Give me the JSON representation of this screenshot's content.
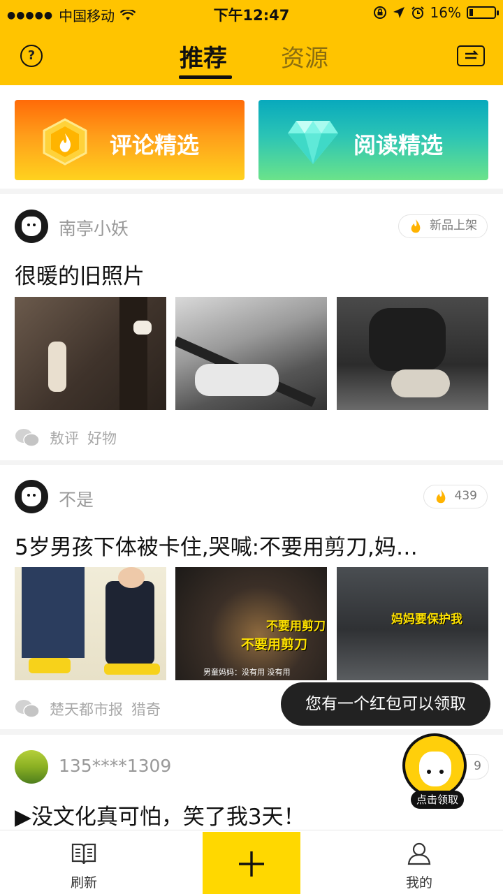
{
  "status_bar": {
    "carrier": "中国移动",
    "time": "下午12:47",
    "battery": "16%",
    "battery_level": 0.16
  },
  "header": {
    "help_icon": "question-circle-icon",
    "tabs": [
      {
        "label": "推荐",
        "active": true
      },
      {
        "label": "资源",
        "active": false
      }
    ],
    "switch_icon": "switch-arrows-icon"
  },
  "featured": [
    {
      "label": "评论精选",
      "icon": "flame-hexagon-icon"
    },
    {
      "label": "阅读精选",
      "icon": "diamond-icon"
    }
  ],
  "posts": [
    {
      "author": "南亭小妖",
      "badge": "新品上架",
      "title": "很暖的旧照片",
      "source": "敖评",
      "category": "好物"
    },
    {
      "author": "不是",
      "badge": "439",
      "title": "5岁男孩下体被卡住,哭喊:不要用剪刀,妈…",
      "captions": [
        "不要用剪刀",
        "不要用剪刀",
        "男童妈妈：没有用 没有用",
        "妈妈要保护我"
      ],
      "source": "楚天都市报",
      "category": "猎奇"
    },
    {
      "author": "135****1309",
      "badge": "9",
      "title": "▶没文化真可怕，笑了我3天！"
    }
  ],
  "toast": {
    "text": "您有一个红包可以领取",
    "claim_label": "点击领取"
  },
  "bottom_nav": {
    "refresh_label": "刷新",
    "mine_label": "我的",
    "add_icon": "plus-icon"
  },
  "colors": {
    "brand_yellow": "#ffc400",
    "add_button_yellow": "#ffd800",
    "orange_card": "#ff8a12",
    "teal_card": "#2bc4b5"
  }
}
